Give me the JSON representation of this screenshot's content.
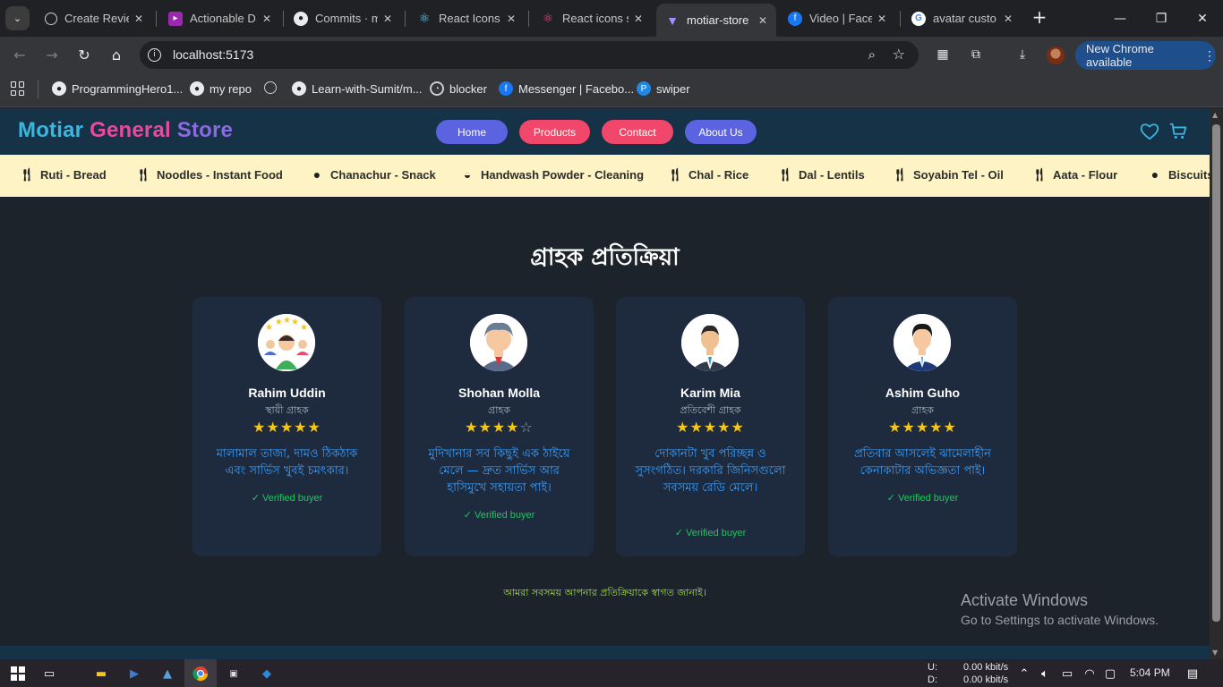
{
  "browser": {
    "tabs": [
      {
        "label": "Create Revie",
        "icon": "chatgpt-icon",
        "color": "#202124"
      },
      {
        "label": "Actionable D",
        "icon": "actionable-icon",
        "color": "#9c27b0"
      },
      {
        "label": "Commits · m",
        "icon": "github-icon",
        "color": "#202124"
      },
      {
        "label": "React Icons",
        "icon": "react-icon",
        "color": "#202124"
      },
      {
        "label": "React icons s",
        "icon": "react-icon",
        "color": "#202124"
      },
      {
        "label": "motiar-store",
        "icon": "vite-icon",
        "color": "#35363a"
      },
      {
        "label": "Video | Face",
        "icon": "facebook-icon",
        "color": "#1877f2"
      },
      {
        "label": "avatar custo",
        "icon": "google-icon",
        "color": "#ffffff"
      }
    ],
    "url": "localhost:5173",
    "new_chrome_label": "New Chrome available",
    "bookmarks": [
      {
        "label": "ProgrammingHero1...",
        "icon": "github-icon"
      },
      {
        "label": "my repo",
        "icon": "github-icon"
      },
      {
        "label": "",
        "icon": "chatgpt-icon"
      },
      {
        "label": "Learn-with-Sumit/m...",
        "icon": "github-icon"
      },
      {
        "label": "blocker",
        "icon": "blocker-icon"
      },
      {
        "label": "Messenger | Facebo...",
        "icon": "facebook-icon"
      },
      {
        "label": "swiper",
        "icon": "swiper-icon"
      }
    ]
  },
  "site": {
    "brand": {
      "w1": "Motiar",
      "w2": "General",
      "w3": "Store"
    },
    "nav": {
      "home": "Home",
      "products": "Products",
      "contact": "Contact",
      "about": "About Us"
    },
    "categories": [
      {
        "label": "Ruti - Bread",
        "icon": "utensils-icon"
      },
      {
        "label": "Noodles - Instant Food",
        "icon": "utensils-icon"
      },
      {
        "label": "Chanachur - Snack",
        "icon": "cookie-icon"
      },
      {
        "label": "Handwash Powder - Cleaning",
        "icon": "soap-icon"
      },
      {
        "label": "Chal - Rice",
        "icon": "utensils-icon"
      },
      {
        "label": "Dal - Lentils",
        "icon": "utensils-icon"
      },
      {
        "label": "Soyabin Tel - Oil",
        "icon": "utensils-icon"
      },
      {
        "label": "Aata - Flour",
        "icon": "utensils-icon"
      },
      {
        "label": "Biscuits",
        "icon": "cookie-icon"
      }
    ],
    "section_title": "গ্রাহক প্রতিক্রিয়া",
    "reviews": [
      {
        "name": "Rahim Uddin",
        "role": "স্থায়ী গ্রাহক",
        "rating": 5,
        "comment": "মালামাল তাজা, দামও ঠিকঠাক এবং সার্ভিস খুবই চমৎকার।",
        "verified": "✓ Verified buyer"
      },
      {
        "name": "Shohan Molla",
        "role": "গ্রাহক",
        "rating": 4,
        "comment": "মুদিখানার সব কিছুই এক ঠাইয়ে মেলে — দ্রুত সার্ভিস আর হাসিমুখে সহায়তা পাই।",
        "verified": "✓ Verified buyer"
      },
      {
        "name": "Karim Mia",
        "role": "প্রতিবেশী গ্রাহক",
        "rating": 5,
        "comment": "দোকানটা খুব পরিচ্ছন্ন ও সুসংগঠিত। দরকারি জিনিসগুলো সবসময় রেডি মেলে।",
        "verified": "✓ Verified buyer"
      },
      {
        "name": "Ashim Guho",
        "role": "গ্রাহক",
        "rating": 5,
        "comment": "প্রতিবার আসলেই ঝামেলাহীন কেনাকাটার অভিজ্ঞতা পাই।",
        "verified": "✓ Verified buyer"
      }
    ],
    "footer_note": "আমরা সবসময় আপনার প্রতিক্রিয়াকে স্বাগত জানাই।"
  },
  "watermark": {
    "line1": "Activate Windows",
    "line2": "Go to Settings to activate Windows."
  },
  "taskbar": {
    "net_up_label": "U:",
    "net_down_label": "D:",
    "net_up": "0.00 kbit/s",
    "net_down": "0.00 kbit/s",
    "time": "5:04 PM"
  }
}
